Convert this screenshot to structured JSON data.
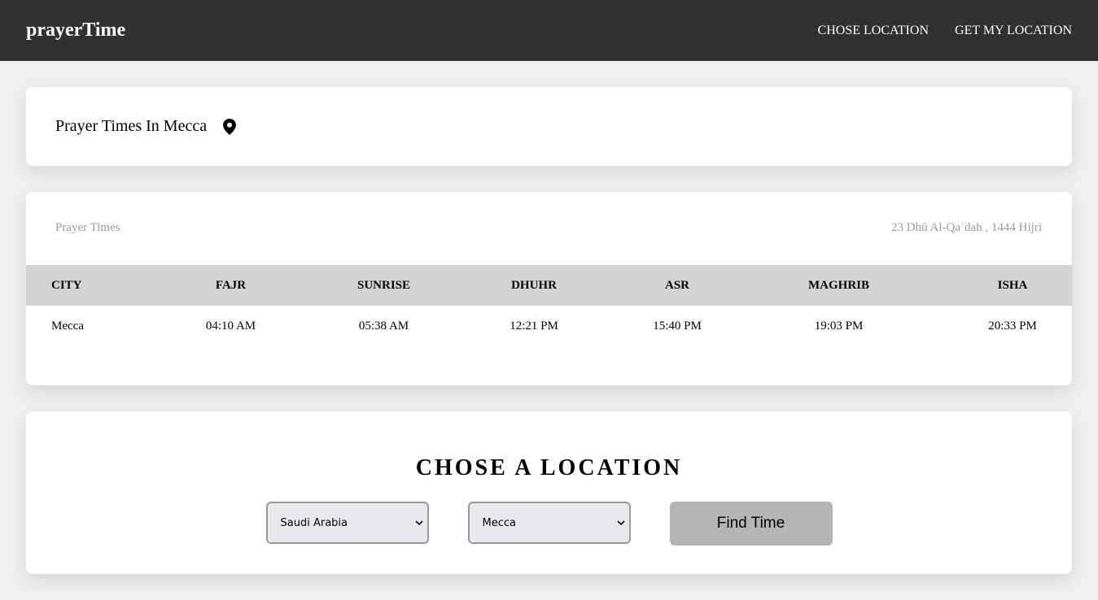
{
  "nav": {
    "brand": "prayerTime",
    "links": [
      "CHOSE LOCATION",
      "GET MY LOCATION"
    ]
  },
  "location_card": {
    "title": "Prayer Times In Mecca",
    "icon": "map-pin-icon"
  },
  "times_card": {
    "label": "Prayer Times",
    "hijri_date": "23 Dhū Al-Qaʿdah , 1444 Hijri",
    "columns": [
      "CITY",
      "FAJR",
      "SUNRISE",
      "DHUHR",
      "ASR",
      "MAGHRIB",
      "ISHA"
    ],
    "rows": [
      [
        "Mecca",
        "04:10 AM",
        "05:38 AM",
        "12:21 PM",
        "15:40 PM",
        "19:03 PM",
        "20:33 PM"
      ]
    ]
  },
  "choose_card": {
    "title": "CHOSE A LOCATION",
    "country_value": "Saudi Arabia",
    "city_value": "Mecca",
    "button_label": "Find Time"
  },
  "colors": {
    "navbar": "#313131",
    "page_bg": "#eeeff1",
    "table_header": "#d3d3d3",
    "button": "#b5b5b5"
  }
}
